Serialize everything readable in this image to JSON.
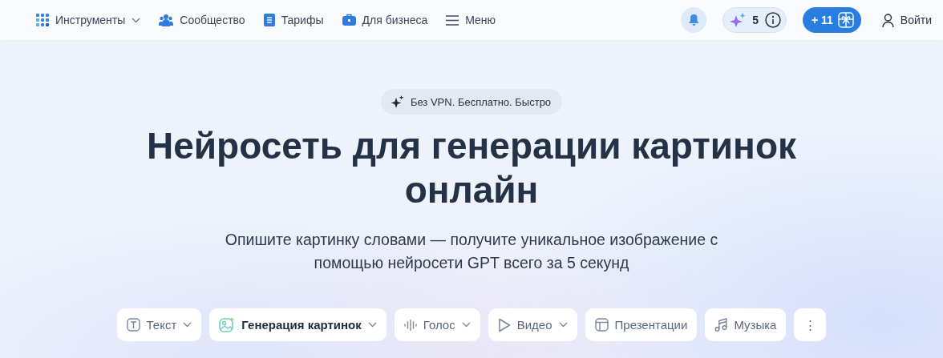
{
  "nav": {
    "items": [
      {
        "label": "Инструменты",
        "kind": "grid",
        "dropdown": true
      },
      {
        "label": "Сообщество",
        "kind": "people",
        "dropdown": false
      },
      {
        "label": "Тарифы",
        "kind": "doc",
        "dropdown": false
      },
      {
        "label": "Для бизнеса",
        "kind": "case",
        "dropdown": false
      },
      {
        "label": "Меню",
        "kind": "menu",
        "dropdown": false
      }
    ],
    "credits": "5",
    "bonus": "+ 11",
    "login": "Войти"
  },
  "hero": {
    "badge": "Без VPN. Бесплатно. Быстро",
    "title": "Нейросеть для генерации картинок онлайн",
    "subtitle": "Опишите картинку словами — получите уникальное изображение с помощью нейросети GPT всего за 5 секунд"
  },
  "tabs": [
    {
      "label": "Текст",
      "kind": "text",
      "dropdown": true,
      "selected": false
    },
    {
      "label": "Генерация картинок",
      "kind": "image",
      "dropdown": true,
      "selected": true
    },
    {
      "label": "Голос",
      "kind": "voice",
      "dropdown": true,
      "selected": false
    },
    {
      "label": "Видео",
      "kind": "video",
      "dropdown": true,
      "selected": false
    },
    {
      "label": "Презентации",
      "kind": "slides",
      "dropdown": false,
      "selected": false
    },
    {
      "label": "Музыка",
      "kind": "music",
      "dropdown": false,
      "selected": false
    },
    {
      "label": "⋮",
      "kind": "more",
      "dropdown": false,
      "selected": false
    }
  ]
}
